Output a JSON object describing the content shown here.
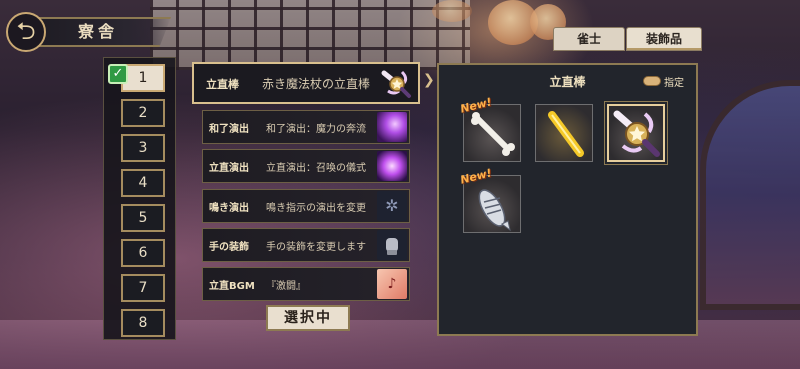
{
  "header": {
    "title": "寮舎",
    "back_icon": "back-arrow-icon"
  },
  "tabs": [
    {
      "label": "雀士",
      "active": false
    },
    {
      "label": "装飾品",
      "active": true
    }
  ],
  "slots": [
    {
      "label": "1",
      "selected": true,
      "checked": true
    },
    {
      "label": "2",
      "selected": false
    },
    {
      "label": "3",
      "selected": false
    },
    {
      "label": "4",
      "selected": false
    },
    {
      "label": "5",
      "selected": false
    },
    {
      "label": "6",
      "selected": false
    },
    {
      "label": "7",
      "selected": false
    },
    {
      "label": "8",
      "selected": false
    }
  ],
  "customize_list": [
    {
      "category": "立直棒",
      "description": "赤き魔法杖の立直棒",
      "icon": "magic-wand-icon",
      "selected": true
    },
    {
      "category": "和了演出",
      "description": "和了演出：魔力の奔流",
      "icon": "magic-swirl-icon"
    },
    {
      "category": "立直演出",
      "description": "立直演出：召喚の儀式",
      "icon": "summon-circle-icon"
    },
    {
      "category": "鳴き演出",
      "description": "鳴き指示の演出を変更",
      "icon": "call-effect-icon"
    },
    {
      "category": "手の装飾",
      "description": "手の装飾を変更します",
      "icon": "hand-icon"
    },
    {
      "category": "立直BGM",
      "description": "『激闘』",
      "icon": "music-icon"
    }
  ],
  "selecting_label": "選択中",
  "item_panel": {
    "title": "立直棒",
    "fixed_label": "指定",
    "items": [
      {
        "name": "bone-stick",
        "new": true,
        "new_label": "New!",
        "selected": false
      },
      {
        "name": "gold-stick",
        "new": false,
        "selected": false
      },
      {
        "name": "magic-wand",
        "new": false,
        "selected": true
      },
      {
        "name": "fish-stick",
        "new": true,
        "new_label": "New!",
        "selected": false
      }
    ]
  }
}
